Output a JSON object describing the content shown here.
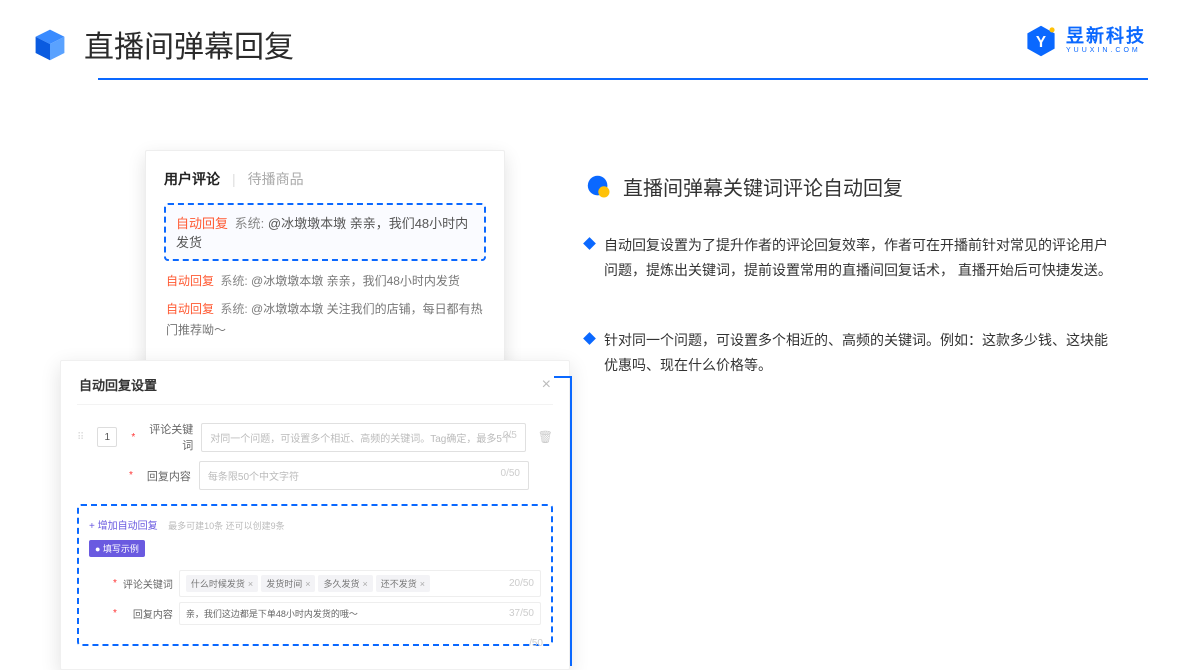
{
  "header": {
    "title": "直播间弹幕回复",
    "brand_cn": "昱新科技",
    "brand_en": "YUUXIN.COM"
  },
  "comments": {
    "tab_active": "用户评论",
    "tab_inactive": "待播商品",
    "highlighted": {
      "tag": "自动回复",
      "sys": "系统:",
      "text": "@冰墩墩本墩 亲亲，我们48小时内发货"
    },
    "rows": [
      {
        "tag": "自动回复",
        "sys": "系统:",
        "text": "@冰墩墩本墩 亲亲，我们48小时内发货"
      },
      {
        "tag": "自动回复",
        "sys": "系统:",
        "text": "@冰墩墩本墩 关注我们的店铺，每日都有热门推荐呦～"
      }
    ]
  },
  "settings": {
    "title": "自动回复设置",
    "num": "1",
    "keyword_label": "评论关键词",
    "keyword_placeholder": "对同一个问题，可设置多个相近、高频的关键词。Tag确定，最多5个",
    "keyword_counter": "0/5",
    "reply_label": "回复内容",
    "reply_placeholder": "每条限50个中文字符",
    "reply_counter": "0/50",
    "add_link": "+ 增加自动回复",
    "add_hint": "最多可建10条 还可以创建9条",
    "example_badge": "● 填写示例",
    "example_keyword_label": "评论关键词",
    "example_tags": [
      "什么时候发货",
      "发货时间",
      "多久发货",
      "还不发货"
    ],
    "example_keyword_counter": "20/50",
    "example_reply_label": "回复内容",
    "example_reply_text": "亲，我们这边都是下单48小时内发货的哦～",
    "example_reply_counter": "37/50",
    "orphan_counter": "/50"
  },
  "right": {
    "section_title": "直播间弹幕关键词评论自动回复",
    "bullets": [
      "自动回复设置为了提升作者的评论回复效率，作者可在开播前针对常见的评论用户问题，提炼出关键词，提前设置常用的直播间回复话术， 直播开始后可快捷发送。",
      "针对同一个问题，可设置多个相近的、高频的关键词。例如：这款多少钱、这块能优惠吗、现在什么价格等。"
    ]
  }
}
